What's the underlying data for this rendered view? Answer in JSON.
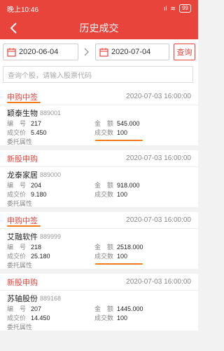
{
  "status_bar": {
    "time": "晚上10:46",
    "signal": "ıl",
    "wifi": "≋",
    "battery": "99"
  },
  "header": {
    "title": "历史成交"
  },
  "filter": {
    "start_date": "2020-06-04",
    "end_date": "2020-07-04",
    "query_label": "查询",
    "search_placeholder": "查询个股，请输入股票代码"
  },
  "labels": {
    "number": "编　号",
    "price": "成交价",
    "attr": "委托属性",
    "amount": "金　额",
    "qty": "成交数"
  },
  "records": [
    {
      "type": "申购中签",
      "time": "2020-07-03 16:00:00",
      "name": "颖泰生物",
      "code": "889001",
      "number": "217",
      "price": "5.450",
      "amount": "545.000",
      "qty": "100",
      "attr": ""
    },
    {
      "type": "新股申购",
      "time": "2020-07-03 16:00:00",
      "name": "龙泰家居",
      "code": "889000",
      "number": "204",
      "price": "9.180",
      "amount": "918.000",
      "qty": "100",
      "attr": ""
    },
    {
      "type": "申购中签",
      "time": "2020-07-03 16:00:00",
      "name": "艾融软件",
      "code": "889999",
      "number": "218",
      "price": "25.180",
      "amount": "2518.000",
      "qty": "100",
      "attr": ""
    },
    {
      "type": "新股申购",
      "time": "2020-07-03 16:00:00",
      "name": "苏轴股份",
      "code": "889168",
      "number": "207",
      "price": "14.450",
      "amount": "1445.000",
      "qty": "100",
      "attr": ""
    }
  ],
  "colors": {
    "accent": "#e8443c",
    "underline": "#f07b1e"
  }
}
